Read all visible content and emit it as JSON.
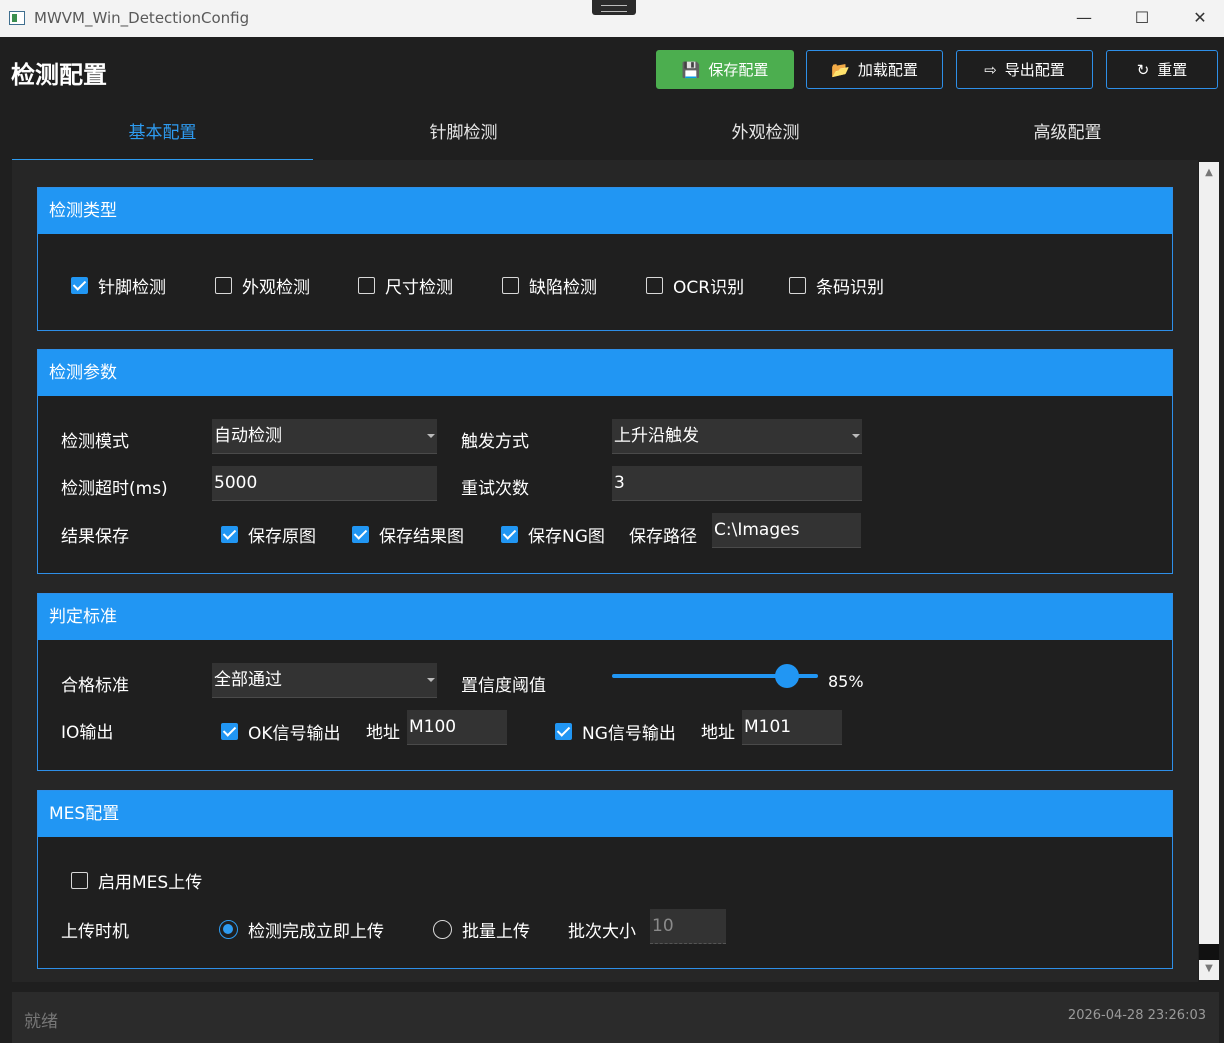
{
  "window": {
    "title": "MWVM_Win_DetectionConfig",
    "controls": {
      "minimize": "—",
      "maximize": "☐",
      "close": "✕"
    }
  },
  "header": {
    "title": "检测配置",
    "buttons": {
      "save": "保存配置",
      "load": "加载配置",
      "export": "导出配置",
      "reset": "重置"
    },
    "colors": {
      "save": "#4cae4f",
      "accent": "#2196f3"
    }
  },
  "tabs": [
    {
      "label": "基本配置",
      "active": true
    },
    {
      "label": "针脚检测",
      "active": false
    },
    {
      "label": "外观检测",
      "active": false
    },
    {
      "label": "高级配置",
      "active": false
    }
  ],
  "detection_type": {
    "title": "检测类型",
    "options": [
      {
        "label": "针脚检测",
        "checked": true
      },
      {
        "label": "外观检测",
        "checked": false
      },
      {
        "label": "尺寸检测",
        "checked": false
      },
      {
        "label": "缺陷检测",
        "checked": false
      },
      {
        "label": "OCR识别",
        "checked": false
      },
      {
        "label": "条码识别",
        "checked": false
      }
    ]
  },
  "detection_params": {
    "title": "检测参数",
    "mode_label": "检测模式",
    "mode_value": "自动检测",
    "trigger_label": "触发方式",
    "trigger_value": "上升沿触发",
    "timeout_label": "检测超时(ms)",
    "timeout_value": "5000",
    "retry_label": "重试次数",
    "retry_value": "3",
    "save_label": "结果保存",
    "save_original": {
      "label": "保存原图",
      "checked": true
    },
    "save_result": {
      "label": "保存结果图",
      "checked": true
    },
    "save_ng": {
      "label": "保存NG图",
      "checked": true
    },
    "path_label": "保存路径",
    "path_value": "C:\\Images"
  },
  "judgement": {
    "title": "判定标准",
    "pass_label": "合格标准",
    "pass_value": "全部通过",
    "confidence_label": "置信度阈值",
    "confidence_value": 0.85,
    "confidence_text": "85%",
    "io_label": "IO输出",
    "ok_output": {
      "label": "OK信号输出",
      "checked": true
    },
    "ok_addr_label": "地址",
    "ok_addr_value": "M100",
    "ng_output": {
      "label": "NG信号输出",
      "checked": true
    },
    "ng_addr_label": "地址",
    "ng_addr_value": "M101"
  },
  "mes": {
    "title": "MES配置",
    "enable": {
      "label": "启用MES上传",
      "checked": false
    },
    "timing_label": "上传时机",
    "timing_immediate": {
      "label": "检测完成立即上传",
      "selected": true
    },
    "timing_batch": {
      "label": "批量上传",
      "selected": false
    },
    "batch_size_label": "批次大小",
    "batch_size_value": "10"
  },
  "status": {
    "text": "就绪",
    "timestamp": "2026-04-28 23:26:03"
  }
}
